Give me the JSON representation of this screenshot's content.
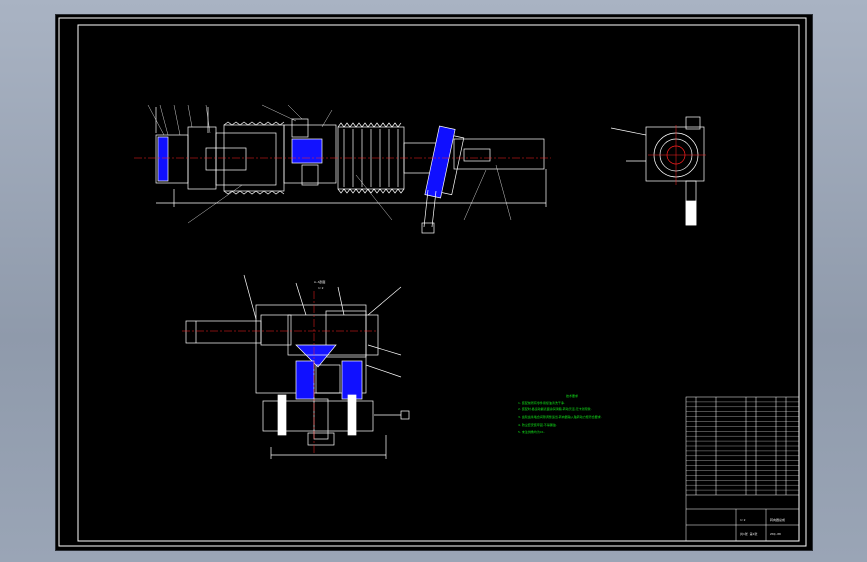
{
  "drawing": {
    "section_label": "A-A剖面",
    "section_scale": "1:2",
    "tech_requirements_title": "技术要求",
    "tech_requirements": [
      "1. 装配前所有零件用煤油清洗干净.",
      "2. 装配时,各运动副表面涂润滑脂,转动灵活,无卡滞现象.",
      "3. 齿轮齿条啮合间隙调整适当,转向器输入轴转动力矩符合要求.",
      "4. 防尘套安装牢固,不得漏油.",
      "5. 未注倒角均为C1."
    ],
    "title_block": {
      "drawing_name": "转向器总成",
      "drawing_no": "ZXQ-00",
      "scale": "1:2",
      "sheet": "共1张 第1张"
    },
    "bom_rows": 20
  },
  "colors": {
    "background": "#000000",
    "frame": "#ffffff",
    "outline": "#ffffff",
    "hatch": "#0000ff",
    "centerline": "#ff0000",
    "text": "#00ff00",
    "leader": "#ffffff"
  }
}
